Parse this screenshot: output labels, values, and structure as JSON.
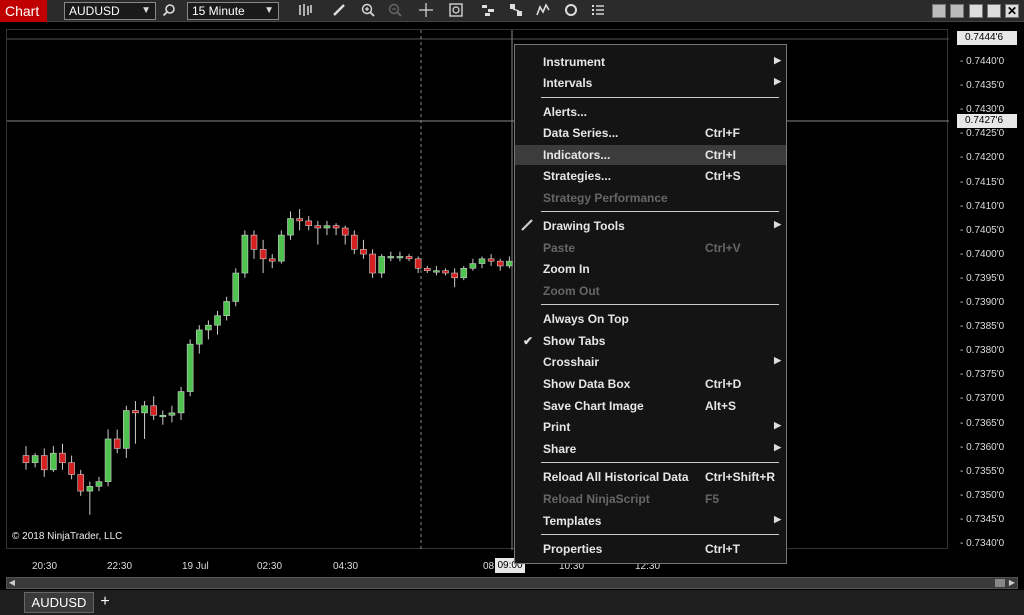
{
  "toolbar": {
    "app_title": "Chart",
    "instrument": "AUDUSD",
    "interval": "15 Minute"
  },
  "chart": {
    "copyright": "© 2018 NinjaTrader, LLC",
    "current_price_tag": "0.7444'6",
    "crosshair_price_tag": "0.7427'6",
    "crosshair_time_tag": "09:00",
    "price_labels": [
      "0.7440'0",
      "0.7435'0",
      "0.7430'0",
      "0.7425'0",
      "0.7420'0",
      "0.7415'0",
      "0.7410'0",
      "0.7405'0",
      "0.7400'0",
      "0.7395'0",
      "0.7390'0",
      "0.7385'0",
      "0.7380'0",
      "0.7375'0",
      "0.7370'0",
      "0.7365'0",
      "0.7360'0",
      "0.7355'0",
      "0.7350'0",
      "0.7345'0",
      "0.7340'0"
    ],
    "time_labels": [
      "20:30",
      "22:30",
      "19 Jul",
      "02:30",
      "04:30",
      "08",
      "10:30",
      "12:30"
    ],
    "up_color": "#4fc24f",
    "down_color": "#d42020"
  },
  "chart_data": {
    "type": "candlestick",
    "instrument": "AUDUSD",
    "interval": "15 Minute",
    "ylim": [
      0.7338,
      0.7446
    ],
    "candles": [
      {
        "o": 0.73575,
        "h": 0.73595,
        "l": 0.73545,
        "c": 0.7356
      },
      {
        "o": 0.7356,
        "h": 0.7358,
        "l": 0.7355,
        "c": 0.73575
      },
      {
        "o": 0.73575,
        "h": 0.7359,
        "l": 0.7353,
        "c": 0.73545
      },
      {
        "o": 0.73545,
        "h": 0.73595,
        "l": 0.7354,
        "c": 0.7358
      },
      {
        "o": 0.7358,
        "h": 0.736,
        "l": 0.73545,
        "c": 0.7356
      },
      {
        "o": 0.7356,
        "h": 0.73575,
        "l": 0.73525,
        "c": 0.73535
      },
      {
        "o": 0.73535,
        "h": 0.73545,
        "l": 0.7349,
        "c": 0.735
      },
      {
        "o": 0.735,
        "h": 0.7352,
        "l": 0.7345,
        "c": 0.7351
      },
      {
        "o": 0.7351,
        "h": 0.7353,
        "l": 0.735,
        "c": 0.7352
      },
      {
        "o": 0.7352,
        "h": 0.7363,
        "l": 0.7351,
        "c": 0.7361
      },
      {
        "o": 0.7361,
        "h": 0.7363,
        "l": 0.7358,
        "c": 0.7359
      },
      {
        "o": 0.7359,
        "h": 0.7368,
        "l": 0.7357,
        "c": 0.7367
      },
      {
        "o": 0.7367,
        "h": 0.7369,
        "l": 0.736,
        "c": 0.73665
      },
      {
        "o": 0.73665,
        "h": 0.7369,
        "l": 0.7361,
        "c": 0.7368
      },
      {
        "o": 0.7368,
        "h": 0.737,
        "l": 0.7365,
        "c": 0.7366
      },
      {
        "o": 0.7366,
        "h": 0.7367,
        "l": 0.7364,
        "c": 0.7366
      },
      {
        "o": 0.7366,
        "h": 0.7368,
        "l": 0.73645,
        "c": 0.73665
      },
      {
        "o": 0.73665,
        "h": 0.7372,
        "l": 0.7365,
        "c": 0.7371
      },
      {
        "o": 0.7371,
        "h": 0.7382,
        "l": 0.737,
        "c": 0.7381
      },
      {
        "o": 0.7381,
        "h": 0.7385,
        "l": 0.7379,
        "c": 0.7384
      },
      {
        "o": 0.7384,
        "h": 0.7386,
        "l": 0.7382,
        "c": 0.7385
      },
      {
        "o": 0.7385,
        "h": 0.7388,
        "l": 0.7383,
        "c": 0.7387
      },
      {
        "o": 0.7387,
        "h": 0.7391,
        "l": 0.7386,
        "c": 0.739
      },
      {
        "o": 0.739,
        "h": 0.7397,
        "l": 0.7389,
        "c": 0.7396
      },
      {
        "o": 0.7396,
        "h": 0.7405,
        "l": 0.7395,
        "c": 0.7404
      },
      {
        "o": 0.7404,
        "h": 0.7405,
        "l": 0.7399,
        "c": 0.7401
      },
      {
        "o": 0.7401,
        "h": 0.7403,
        "l": 0.7396,
        "c": 0.7399
      },
      {
        "o": 0.7399,
        "h": 0.74,
        "l": 0.7397,
        "c": 0.73985
      },
      {
        "o": 0.73985,
        "h": 0.7405,
        "l": 0.7398,
        "c": 0.7404
      },
      {
        "o": 0.7404,
        "h": 0.7409,
        "l": 0.7403,
        "c": 0.74075
      },
      {
        "o": 0.74075,
        "h": 0.74095,
        "l": 0.7405,
        "c": 0.7407
      },
      {
        "o": 0.7407,
        "h": 0.7408,
        "l": 0.7405,
        "c": 0.7406
      },
      {
        "o": 0.7406,
        "h": 0.7407,
        "l": 0.7402,
        "c": 0.74055
      },
      {
        "o": 0.74055,
        "h": 0.7407,
        "l": 0.7404,
        "c": 0.7406
      },
      {
        "o": 0.7406,
        "h": 0.74065,
        "l": 0.7404,
        "c": 0.74055
      },
      {
        "o": 0.74055,
        "h": 0.7406,
        "l": 0.7402,
        "c": 0.7404
      },
      {
        "o": 0.7404,
        "h": 0.7405,
        "l": 0.74,
        "c": 0.7401
      },
      {
        "o": 0.7401,
        "h": 0.7403,
        "l": 0.7399,
        "c": 0.74
      },
      {
        "o": 0.74,
        "h": 0.7401,
        "l": 0.7395,
        "c": 0.7396
      },
      {
        "o": 0.7396,
        "h": 0.74,
        "l": 0.7395,
        "c": 0.73995
      },
      {
        "o": 0.73995,
        "h": 0.74005,
        "l": 0.73985,
        "c": 0.73995
      },
      {
        "o": 0.73995,
        "h": 0.74005,
        "l": 0.73985,
        "c": 0.73995
      },
      {
        "o": 0.73995,
        "h": 0.74,
        "l": 0.73985,
        "c": 0.7399
      },
      {
        "o": 0.7399,
        "h": 0.73995,
        "l": 0.7396,
        "c": 0.7397
      },
      {
        "o": 0.7397,
        "h": 0.73975,
        "l": 0.7396,
        "c": 0.73965
      },
      {
        "o": 0.73965,
        "h": 0.73975,
        "l": 0.73955,
        "c": 0.73965
      },
      {
        "o": 0.73965,
        "h": 0.7397,
        "l": 0.73955,
        "c": 0.7396
      },
      {
        "o": 0.7396,
        "h": 0.7397,
        "l": 0.7393,
        "c": 0.7395
      },
      {
        "o": 0.7395,
        "h": 0.73975,
        "l": 0.73945,
        "c": 0.7397
      },
      {
        "o": 0.7397,
        "h": 0.7399,
        "l": 0.73965,
        "c": 0.7398
      },
      {
        "o": 0.7398,
        "h": 0.73995,
        "l": 0.7397,
        "c": 0.7399
      },
      {
        "o": 0.7399,
        "h": 0.74,
        "l": 0.73975,
        "c": 0.73985
      },
      {
        "o": 0.73985,
        "h": 0.7399,
        "l": 0.73965,
        "c": 0.73975
      },
      {
        "o": 0.73975,
        "h": 0.73995,
        "l": 0.7397,
        "c": 0.73985
      }
    ]
  },
  "menu": {
    "items": [
      {
        "label": "Instrument",
        "shortcut": "",
        "submenu": true,
        "disabled": false
      },
      {
        "label": "Intervals",
        "shortcut": "",
        "submenu": true,
        "disabled": false
      },
      {
        "label": "Alerts...",
        "shortcut": "",
        "submenu": false,
        "disabled": false
      },
      {
        "label": "Data Series...",
        "shortcut": "Ctrl+F",
        "submenu": false,
        "disabled": false
      },
      {
        "label": "Indicators...",
        "shortcut": "Ctrl+I",
        "submenu": false,
        "disabled": false
      },
      {
        "label": "Strategies...",
        "shortcut": "Ctrl+S",
        "submenu": false,
        "disabled": false
      },
      {
        "label": "Strategy Performance",
        "shortcut": "",
        "submenu": false,
        "disabled": true
      },
      {
        "label": "Drawing Tools",
        "shortcut": "",
        "submenu": true,
        "disabled": false
      },
      {
        "label": "Paste",
        "shortcut": "Ctrl+V",
        "submenu": false,
        "disabled": true
      },
      {
        "label": "Zoom In",
        "shortcut": "",
        "submenu": false,
        "disabled": false
      },
      {
        "label": "Zoom Out",
        "shortcut": "",
        "submenu": false,
        "disabled": true
      },
      {
        "label": "Always On Top",
        "shortcut": "",
        "submenu": false,
        "disabled": false
      },
      {
        "label": "Show Tabs",
        "shortcut": "",
        "submenu": false,
        "disabled": false
      },
      {
        "label": "Crosshair",
        "shortcut": "",
        "submenu": true,
        "disabled": false
      },
      {
        "label": "Show Data Box",
        "shortcut": "Ctrl+D",
        "submenu": false,
        "disabled": false
      },
      {
        "label": "Save Chart Image",
        "shortcut": "Alt+S",
        "submenu": false,
        "disabled": false
      },
      {
        "label": "Print",
        "shortcut": "",
        "submenu": true,
        "disabled": false
      },
      {
        "label": "Share",
        "shortcut": "",
        "submenu": true,
        "disabled": false
      },
      {
        "label": "Reload All Historical Data",
        "shortcut": "Ctrl+Shift+R",
        "submenu": false,
        "disabled": false
      },
      {
        "label": "Reload NinjaScript",
        "shortcut": "F5",
        "submenu": false,
        "disabled": true
      },
      {
        "label": "Templates",
        "shortcut": "",
        "submenu": true,
        "disabled": false
      },
      {
        "label": "Properties",
        "shortcut": "Ctrl+T",
        "submenu": false,
        "disabled": false
      }
    ]
  },
  "tabs": {
    "items": [
      "AUDUSD"
    ],
    "add_label": "+"
  }
}
